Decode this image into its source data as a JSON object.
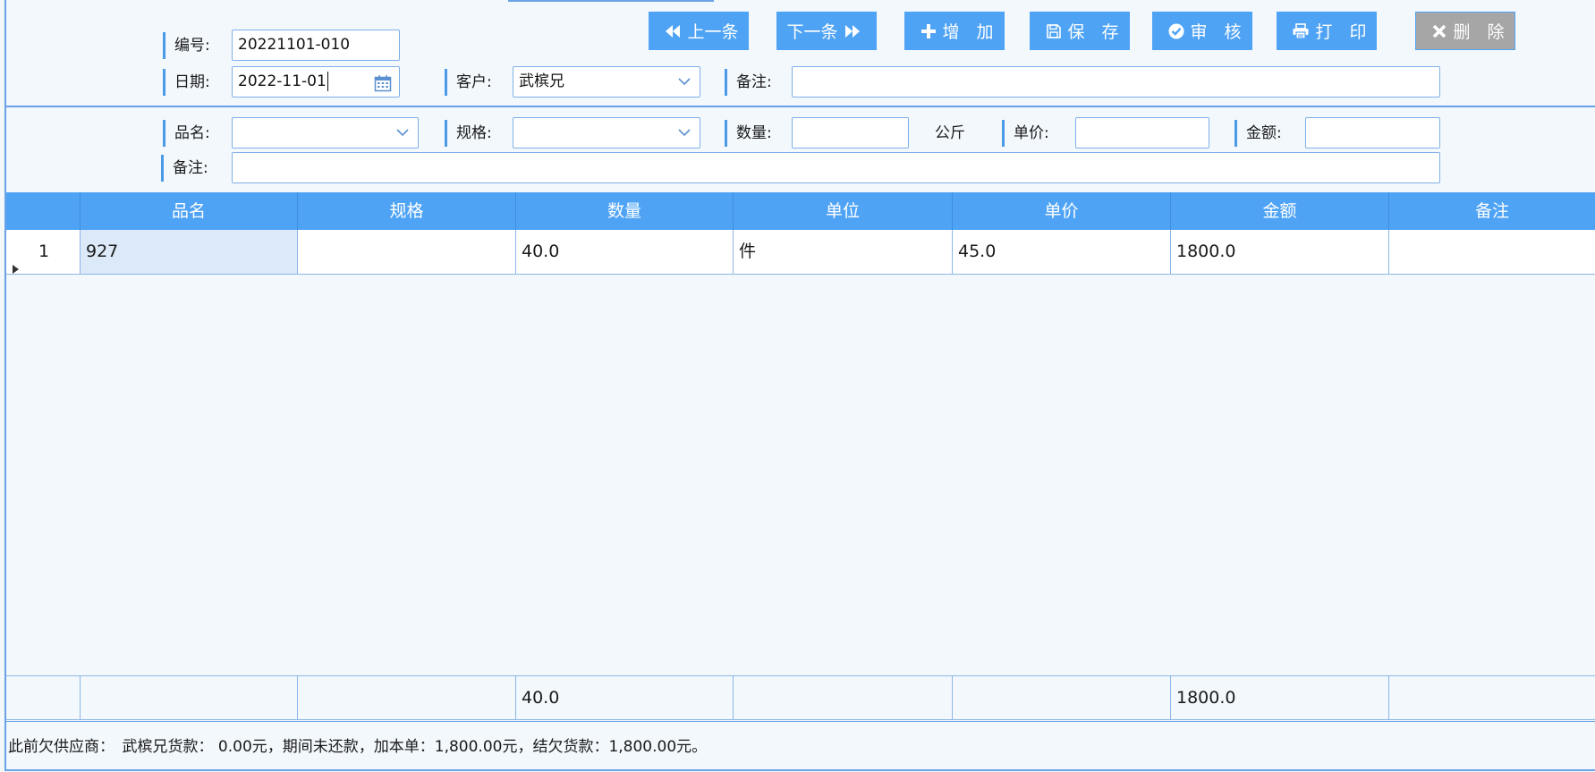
{
  "header": {
    "number_label": "编号:",
    "number_value": "20221101-010",
    "date_label": "日期:",
    "date_value": "2022-11-01",
    "customer_label": "客户:",
    "customer_value": "武槟兄",
    "note_label": "备注:",
    "note_value": ""
  },
  "toolbar": {
    "prev_label": "上一条",
    "next_label": "下一条",
    "add_label": "增　加",
    "save_label": "保　存",
    "audit_label": "审　核",
    "print_label": "打　印",
    "delete_label": "删　除"
  },
  "entry": {
    "product_label": "品名:",
    "product_value": "",
    "spec_label": "规格:",
    "spec_value": "",
    "qty_label": "数量:",
    "qty_value": "",
    "unit_text": "公斤",
    "price_label": "单价:",
    "price_value": "",
    "amount_label": "金额:",
    "amount_value": "",
    "note_label": "备注:",
    "note_value": ""
  },
  "table": {
    "columns": [
      "品名",
      "规格",
      "数量",
      "单位",
      "单价",
      "金额",
      "备注"
    ],
    "rows": [
      {
        "index": "1",
        "product": "927",
        "spec": "",
        "qty": "40.0",
        "unit": "件",
        "price": "45.0",
        "amount": "1800.0",
        "note": ""
      }
    ],
    "summary": {
      "qty": "40.0",
      "amount": "1800.0"
    }
  },
  "footer": {
    "text": "此前欠供应商：　武槟兄货款：  0.00元，期间未还款，加本单：1,800.00元，结欠货款：1,800.00元。"
  },
  "colors": {
    "accent": "#4fa3f5",
    "border": "#6aa3e6",
    "background": "#f3f8fd",
    "disabled": "#a6a6a6"
  }
}
